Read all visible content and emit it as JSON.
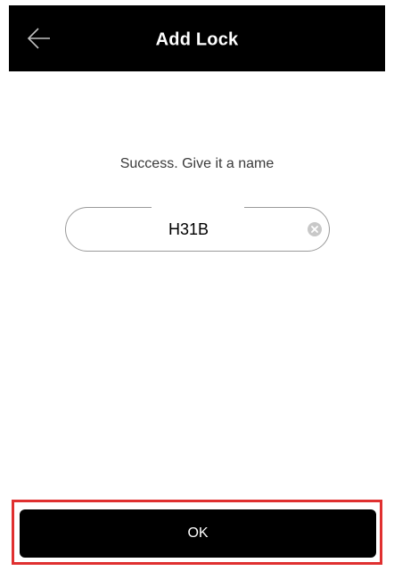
{
  "header": {
    "title": "Add Lock",
    "back_icon": "arrow-left-icon",
    "background_color": "#000000"
  },
  "main": {
    "prompt": "Success. Give it a name",
    "name_field": {
      "value": "H31B",
      "clear_icon": "clear-circle-icon"
    }
  },
  "footer": {
    "ok_label": "OK",
    "highlight_color": "#e03030"
  }
}
